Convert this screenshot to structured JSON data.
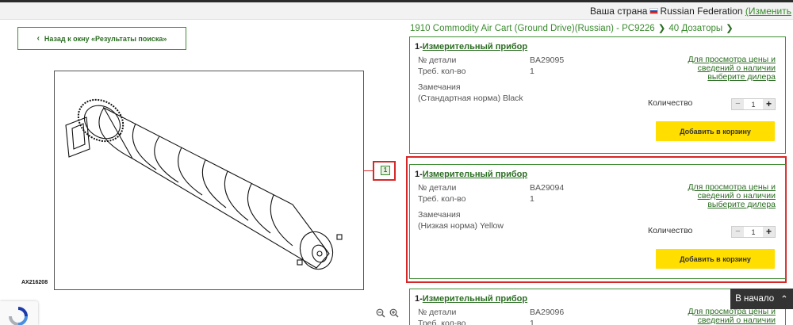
{
  "header": {
    "country_label": "Ваша страна",
    "country_name": "Russian Federation",
    "change_link": "(Изменить"
  },
  "back_button": {
    "label": "Назад к окну «Результаты поиска»"
  },
  "breadcrumb": {
    "model": "1910 Commodity Air Cart (Ground Drive)(Russian) - PC9226",
    "section": "40 Дозаторы"
  },
  "diagram": {
    "figure_id": "AX216208",
    "callout": "1"
  },
  "labels": {
    "part_no": "№ детали",
    "req_qty": "Треб. кол-во",
    "remarks": "Замечания",
    "dealer": "Для просмотра цены и сведений о наличии выберите дилера",
    "quantity": "Количество",
    "add_to_cart": "Добавить в корзину"
  },
  "parts": [
    {
      "ref": "1",
      "name": "Измерительный прибор",
      "part_number": "BA29095",
      "req_qty": "1",
      "remark": "(Стандартная норма) Black",
      "qty": "1"
    },
    {
      "ref": "1",
      "name": "Измерительный прибор",
      "part_number": "BA29094",
      "req_qty": "1",
      "remark": "(Низкая норма) Yellow",
      "qty": "1"
    },
    {
      "ref": "1",
      "name": "Измерительный прибор",
      "part_number": "BA29096",
      "req_qty": "1"
    }
  ],
  "back_to_top": {
    "label": "В начало"
  }
}
